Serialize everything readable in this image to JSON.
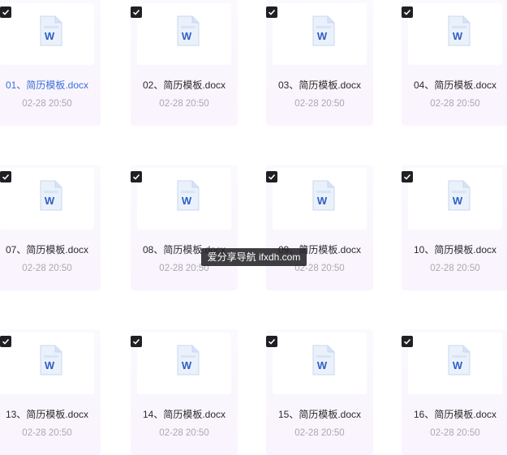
{
  "files": [
    {
      "name": "01、简历模板.docx",
      "time": "02-28 20:50",
      "checked": true,
      "active": true
    },
    {
      "name": "02、简历模板.docx",
      "time": "02-28 20:50",
      "checked": true,
      "active": false
    },
    {
      "name": "03、简历模板.docx",
      "time": "02-28 20:50",
      "checked": true,
      "active": false
    },
    {
      "name": "04、简历模板.docx",
      "time": "02-28 20:50",
      "checked": true,
      "active": false
    },
    {
      "name": "07、简历模板.docx",
      "time": "02-28 20:50",
      "checked": true,
      "active": false
    },
    {
      "name": "08、简历模板.docx",
      "time": "02-28 20:50",
      "checked": true,
      "active": false
    },
    {
      "name": "09、简历模板.docx",
      "time": "02-28 20:50",
      "checked": true,
      "active": false
    },
    {
      "name": "10、简历模板.docx",
      "time": "02-28 20:50",
      "checked": true,
      "active": false
    },
    {
      "name": "13、简历模板.docx",
      "time": "02-28 20:50",
      "checked": true,
      "active": false
    },
    {
      "name": "14、简历模板.docx",
      "time": "02-28 20:50",
      "checked": true,
      "active": false
    },
    {
      "name": "15、简历模板.docx",
      "time": "02-28 20:50",
      "checked": true,
      "active": false
    },
    {
      "name": "16、简历模板.docx",
      "time": "02-28 20:50",
      "checked": true,
      "active": false
    }
  ],
  "file_icon": {
    "name": "word-doc-icon",
    "letter": "W",
    "color": "#2f5fc4"
  },
  "checkbox_icon": "checkbox-checked-icon",
  "watermark": "爱分享导航 ifxdh.com"
}
